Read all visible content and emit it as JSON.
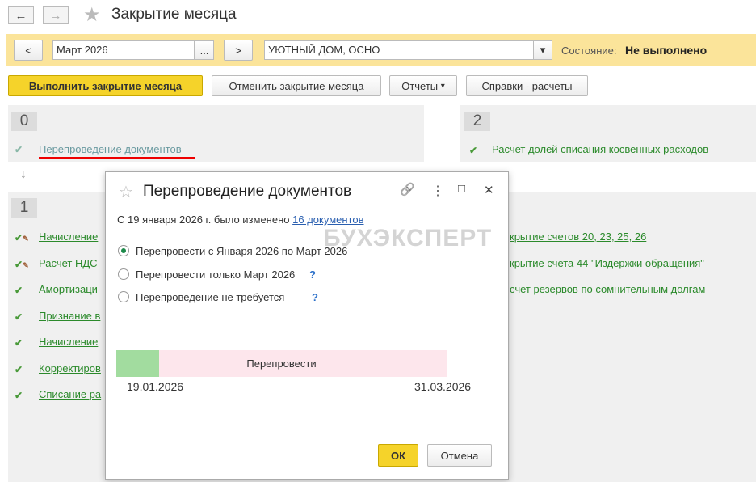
{
  "window": {
    "title": "Закрытие месяца",
    "back_icon": "←",
    "forward_icon": "→",
    "star_icon": "★"
  },
  "toolbar": {
    "prev": "<",
    "period": "Март 2026",
    "period_select": "...",
    "next": ">",
    "organization": "УЮТНЫЙ ДОМ, ОСНО",
    "org_dropdown": "▾",
    "state_label": "Состояние:",
    "state_value": "Не выполнено"
  },
  "actions": {
    "run": "Выполнить закрытие месяца",
    "cancel": "Отменить закрытие месяца",
    "reports": "Отчеты",
    "reports_arrow": "▾",
    "help": "Справки - расчеты"
  },
  "stage0": {
    "number": "0",
    "items": [
      {
        "label": "Перепроведение документов"
      }
    ]
  },
  "stage2": {
    "number": "2",
    "items": [
      {
        "label": "Расчет долей списания косвенных расходов"
      }
    ]
  },
  "stage1": {
    "number": "1",
    "items": [
      {
        "label": "Начисление"
      },
      {
        "label": "Расчет НДС"
      },
      {
        "label": "Амортизаци"
      },
      {
        "label": "Признание в"
      },
      {
        "label": "Начисление"
      },
      {
        "label": "Корректиров"
      },
      {
        "label": "Списание ра"
      }
    ],
    "right_items": [
      {
        "label": "крытие счетов 20, 23, 25, 26"
      },
      {
        "label": "крытие счета 44 \"Издержки обращения\""
      },
      {
        "label": "счет резервов по сомнительным долгам"
      }
    ]
  },
  "arrow_down": "↓",
  "dialog": {
    "title": "Перепроведение документов",
    "star": "☆",
    "link_icon": "🔗",
    "more_icon": "⋮",
    "maximize_icon": "□",
    "close_icon": "✕",
    "info_prefix": "С 19 января 2026 г. было изменено",
    "info_link": "16 документов",
    "options": [
      {
        "label": "Перепровести с Января 2026 по Март 2026",
        "selected": true
      },
      {
        "label": "Перепровести только Март 2026",
        "help": "?"
      },
      {
        "label": "Перепроведение не требуется",
        "help": "?"
      }
    ],
    "timeline": {
      "label": "Перепровести",
      "start": "19.01.2026",
      "end": "31.03.2026",
      "done_fraction": 0.13
    },
    "ok": "ОК",
    "cancel": "Отмена"
  },
  "watermark": "БУХЭКСПЕРТ",
  "colors": {
    "accent": "#fbe49a",
    "link": "#2b8a2b",
    "primary_button": "#f5d32a"
  }
}
